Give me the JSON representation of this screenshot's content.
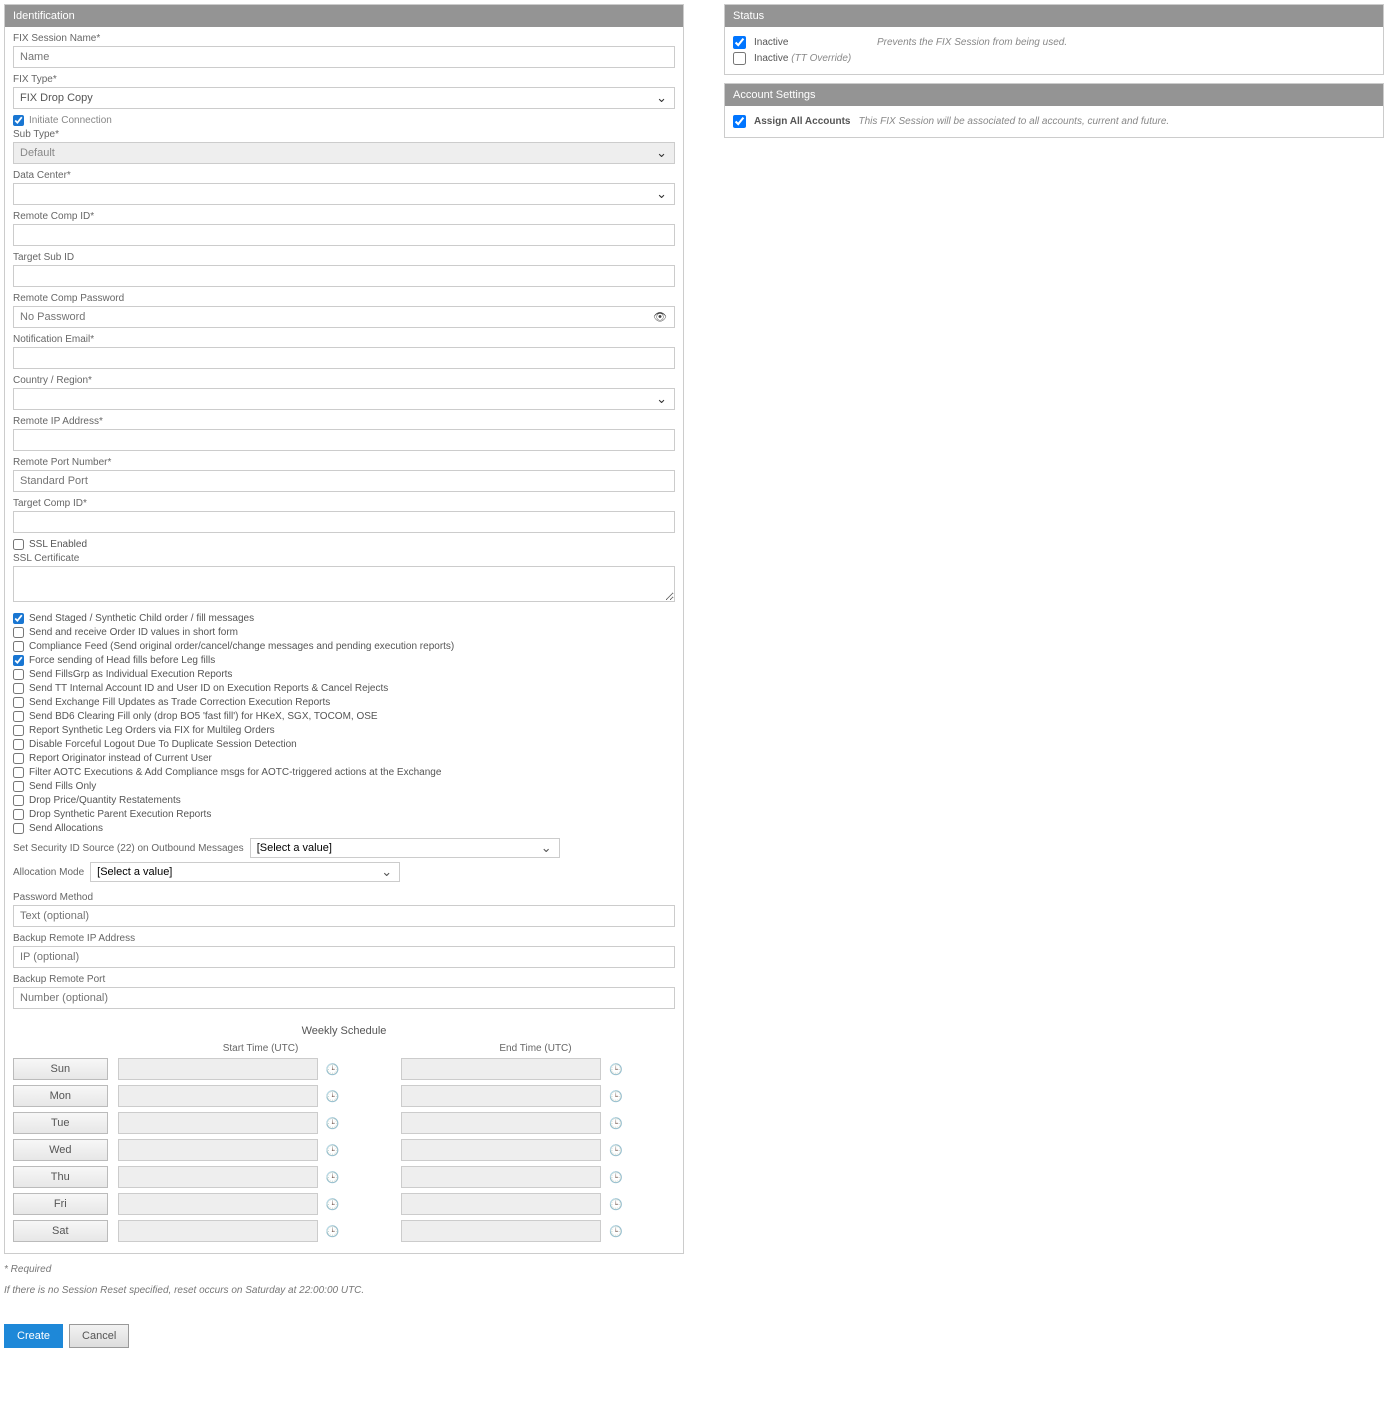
{
  "identification": {
    "header": "Identification",
    "fields": {
      "sessionName": {
        "label": "FIX Session Name*",
        "placeholder": "Name"
      },
      "fixType": {
        "label": "FIX Type*",
        "value": "FIX Drop Copy"
      },
      "initiateConnection": {
        "label": "Initiate Connection",
        "checked": true
      },
      "subType": {
        "label": "Sub Type*",
        "value": "Default"
      },
      "dataCenter": {
        "label": "Data Center*",
        "value": ""
      },
      "remoteCompId": {
        "label": "Remote Comp ID*",
        "value": ""
      },
      "targetSubId": {
        "label": "Target Sub ID",
        "value": ""
      },
      "remoteCompPassword": {
        "label": "Remote Comp Password",
        "placeholder": "No Password"
      },
      "notificationEmail": {
        "label": "Notification Email*",
        "value": ""
      },
      "countryRegion": {
        "label": "Country / Region*",
        "value": ""
      },
      "remoteIp": {
        "label": "Remote IP Address*",
        "value": ""
      },
      "remotePort": {
        "label": "Remote Port Number*",
        "placeholder": "Standard Port"
      },
      "targetCompId": {
        "label": "Target Comp ID*",
        "value": ""
      },
      "sslEnabled": {
        "label": "SSL Enabled",
        "checked": false
      },
      "sslCertificate": {
        "label": "SSL Certificate",
        "value": ""
      }
    },
    "checkboxes": [
      {
        "label": "Send Staged / Synthetic Child order / fill messages",
        "checked": true
      },
      {
        "label": "Send and receive Order ID values in short form",
        "checked": false
      },
      {
        "label": "Compliance Feed (Send original order/cancel/change messages and pending execution reports)",
        "checked": false
      },
      {
        "label": "Force sending of Head fills before Leg fills",
        "checked": true
      },
      {
        "label": "Send FillsGrp as Individual Execution Reports",
        "checked": false
      },
      {
        "label": "Send TT Internal Account ID and User ID on Execution Reports & Cancel Rejects",
        "checked": false
      },
      {
        "label": "Send Exchange Fill Updates as Trade Correction Execution Reports",
        "checked": false
      },
      {
        "label": "Send BD6 Clearing Fill only (drop BO5 'fast fill') for HKeX, SGX, TOCOM, OSE",
        "checked": false
      },
      {
        "label": "Report Synthetic Leg Orders via FIX for Multileg Orders",
        "checked": false
      },
      {
        "label": "Disable Forceful Logout Due To Duplicate Session Detection",
        "checked": false
      },
      {
        "label": "Report Originator instead of Current User",
        "checked": false
      },
      {
        "label": "Filter AOTC Executions & Add Compliance msgs for AOTC-triggered actions at the Exchange",
        "checked": false
      },
      {
        "label": "Send Fills Only",
        "checked": false
      },
      {
        "label": "Drop Price/Quantity Restatements",
        "checked": false
      },
      {
        "label": "Drop Synthetic Parent Execution Reports",
        "checked": false
      },
      {
        "label": "Send Allocations",
        "checked": false
      }
    ],
    "securityIdSource": {
      "label": "Set Security ID Source (22) on Outbound Messages",
      "value": "[Select a value]"
    },
    "allocationMode": {
      "label": "Allocation Mode",
      "value": "[Select a value]"
    },
    "passwordMethod": {
      "label": "Password Method",
      "placeholder": "Text (optional)"
    },
    "backupIp": {
      "label": "Backup Remote IP Address",
      "placeholder": "IP (optional)"
    },
    "backupPort": {
      "label": "Backup Remote Port",
      "placeholder": "Number (optional)"
    },
    "schedule": {
      "title": "Weekly Schedule",
      "startHeader": "Start Time (UTC)",
      "endHeader": "End Time (UTC)",
      "days": [
        "Sun",
        "Mon",
        "Tue",
        "Wed",
        "Thu",
        "Fri",
        "Sat"
      ]
    }
  },
  "status": {
    "header": "Status",
    "rows": [
      {
        "label": "Inactive",
        "checked": true,
        "desc": "Prevents the FIX Session from being used.",
        "suffix": ""
      },
      {
        "label": "Inactive",
        "checked": false,
        "desc": "",
        "suffix": "(TT Override)"
      }
    ]
  },
  "accountSettings": {
    "header": "Account Settings",
    "row": {
      "label": "Assign All Accounts",
      "checked": true,
      "desc": "This FIX Session will be associated to all accounts, current and future."
    }
  },
  "footnotes": {
    "required": "* Required",
    "reset": "If there is no Session Reset specified, reset occurs on Saturday at 22:00:00 UTC."
  },
  "buttons": {
    "create": "Create",
    "cancel": "Cancel"
  }
}
